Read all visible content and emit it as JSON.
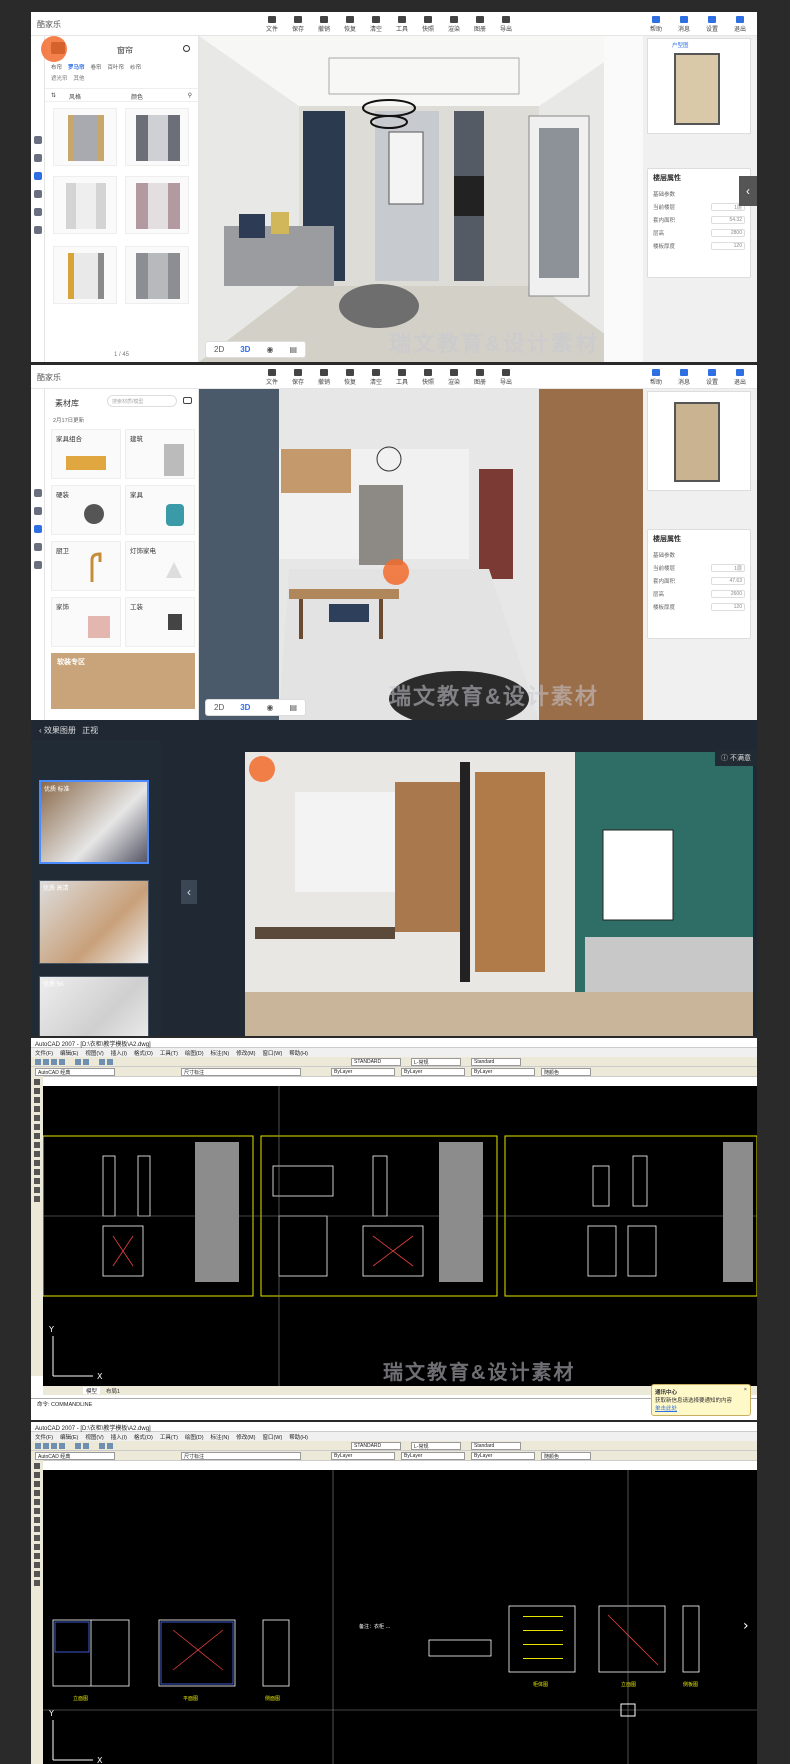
{
  "panel1": {
    "logo": "酷家乐",
    "toolbar": [
      "文件",
      "保存",
      "撤销",
      "恢复",
      "清空",
      "工具",
      "快照",
      "渲染",
      "图册",
      "导出"
    ],
    "right_toolbar": [
      "帮助",
      "消息",
      "设置",
      "退出"
    ],
    "side_title": "窗帘",
    "side_tabs": [
      "布帘",
      "罗马帘",
      "卷帘",
      "百叶帘",
      "纱帘"
    ],
    "side_sub": [
      "遮光帘",
      "其他"
    ],
    "filter1": "风格",
    "filter2": "颜色",
    "page": "1 / 45",
    "prop_title": "楼层属性",
    "prop_section": "基础参数",
    "rows": [
      {
        "label": "当前楼层",
        "value": "1层"
      },
      {
        "label": "套内面积",
        "value": "54.32"
      },
      {
        "label": "层高",
        "value": "2800"
      },
      {
        "label": "楼板厚度",
        "value": "120"
      }
    ],
    "view_2d": "2D",
    "view_3d": "3D",
    "minimap_label": "户型图",
    "watermark": "瑞文教育&设计素材"
  },
  "panel2": {
    "logo": "酷家乐",
    "toolbar": [
      "文件",
      "保存",
      "撤销",
      "恢复",
      "清空",
      "工具",
      "快照",
      "渲染",
      "图册",
      "导出"
    ],
    "right_toolbar": [
      "帮助",
      "消息",
      "设置",
      "退出"
    ],
    "side_title": "素材库",
    "search_placeholder": "搜索材质/模型",
    "update": "2月17日更新",
    "cats": [
      "家具组合",
      "建筑",
      "硬装",
      "家具",
      "厨卫",
      "灯饰家电",
      "家饰",
      "工装"
    ],
    "banner": "软装专区",
    "prop_title": "楼层属性",
    "prop_section": "基础参数",
    "rows": [
      {
        "label": "当前楼层",
        "value": "1层"
      },
      {
        "label": "套内面积",
        "value": "47.63"
      },
      {
        "label": "层高",
        "value": "2600"
      },
      {
        "label": "楼板厚度",
        "value": "120"
      }
    ],
    "view_2d": "2D",
    "view_3d": "3D",
    "watermark": "瑞文教育&设计素材"
  },
  "panel3": {
    "breadcrumb": "效果图册",
    "current": "正视",
    "items": [
      {
        "tag": "优质 标准"
      },
      {
        "tag": "优质 高清"
      },
      {
        "tag": "优质 5K"
      }
    ],
    "dissatisfied": "不满意"
  },
  "cad1": {
    "title": "AutoCAD 2007 - [D:\\衣柜\\教学模板\\A2.dwg]",
    "menus": [
      "文件(F)",
      "编辑(E)",
      "视图(V)",
      "插入(I)",
      "格式(O)",
      "工具(T)",
      "绘图(D)",
      "标注(N)",
      "修改(M)",
      "窗口(W)",
      "帮助(H)"
    ],
    "workspace": "AutoCAD 经典",
    "dim_style": "尺寸标注",
    "text_style": "STANDARD",
    "dim_combo": "L-常规",
    "table_style": "Standard",
    "layer": "ByLayer",
    "linetype": "ByLayer",
    "lineweight": "ByLayer",
    "color": "随颜色",
    "tabs": [
      "模型",
      "布局1"
    ],
    "command": "命令: COMMANDLINE",
    "popup_title": "通讯中心",
    "popup_text": "获取新信息请选择要通知的内容",
    "popup_link": "单击此处",
    "watermark": "瑞文教育&设计素材"
  },
  "cad2": {
    "title": "AutoCAD 2007 - [D:\\衣柜\\教学模板\\A2.dwg]",
    "menus": [
      "文件(F)",
      "编辑(E)",
      "视图(V)",
      "插入(I)",
      "格式(O)",
      "工具(T)",
      "绘图(D)",
      "标注(N)",
      "修改(M)",
      "窗口(W)",
      "帮助(H)"
    ],
    "workspace": "AutoCAD 经典",
    "dim_style": "尺寸标注",
    "text_style": "STANDARD",
    "dim_combo": "L-常规",
    "table_style": "Standard",
    "layer": "ByLayer",
    "linetype": "ByLayer",
    "lineweight": "ByLayer",
    "color": "随颜色",
    "note": "备注：衣柜 ...",
    "labels": [
      "立面图",
      "平面图",
      "侧面图",
      "柜体图",
      "立面图",
      "侧板图"
    ]
  },
  "colors": {
    "accent": "#2f6fe4",
    "cursor": "#f26b2b",
    "cad_bg": "#000000",
    "cad_yellow": "#e6e600"
  }
}
